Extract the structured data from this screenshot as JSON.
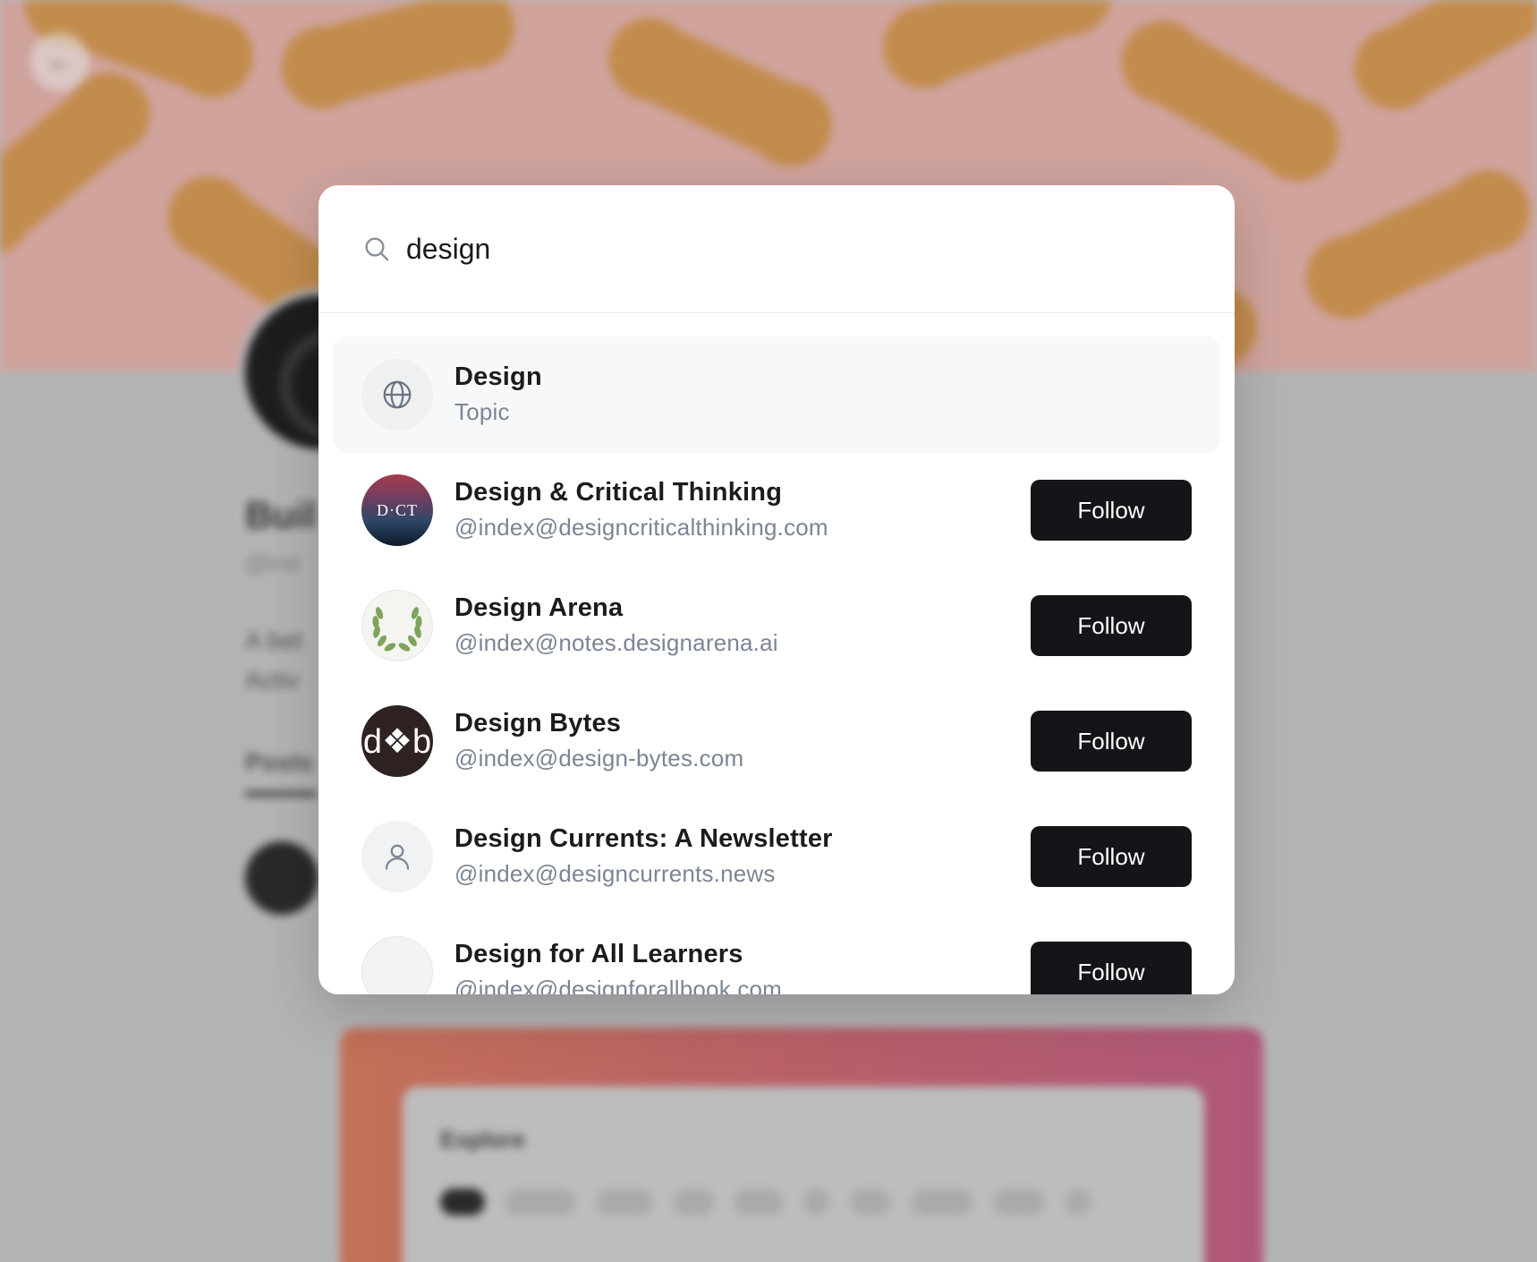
{
  "background": {
    "profile_name": "Buil",
    "profile_handle": "@ind",
    "bio_lines": [
      "A bet",
      "Activ"
    ],
    "posts_tab": "Posts",
    "explore_title": "Explore"
  },
  "search": {
    "query": "design",
    "icon": "search-icon"
  },
  "results": [
    {
      "title": "Design",
      "subtitle": "Topic",
      "avatar": "globe-icon",
      "follow": ""
    },
    {
      "title": "Design & Critical Thinking",
      "subtitle": "@index@designcriticalthinking.com",
      "avatar": "D·CT",
      "follow": "Follow"
    },
    {
      "title": "Design Arena",
      "subtitle": "@index@notes.designarena.ai",
      "avatar": "laurel-icon",
      "follow": "Follow"
    },
    {
      "title": "Design Bytes",
      "subtitle": "@index@design-bytes.com",
      "avatar": "d❖b",
      "follow": "Follow"
    },
    {
      "title": "Design Currents: A Newsletter",
      "subtitle": "@index@designcurrents.news",
      "avatar": "person-icon",
      "follow": "Follow"
    },
    {
      "title": "Design for All Learners",
      "subtitle": "@index@designforallbook.com",
      "avatar": "blank-avatar",
      "follow": "Follow"
    }
  ],
  "colors": {
    "follow_button": "#141518",
    "subtitle": "#7b8594",
    "active_row": "#f7f8f9"
  }
}
